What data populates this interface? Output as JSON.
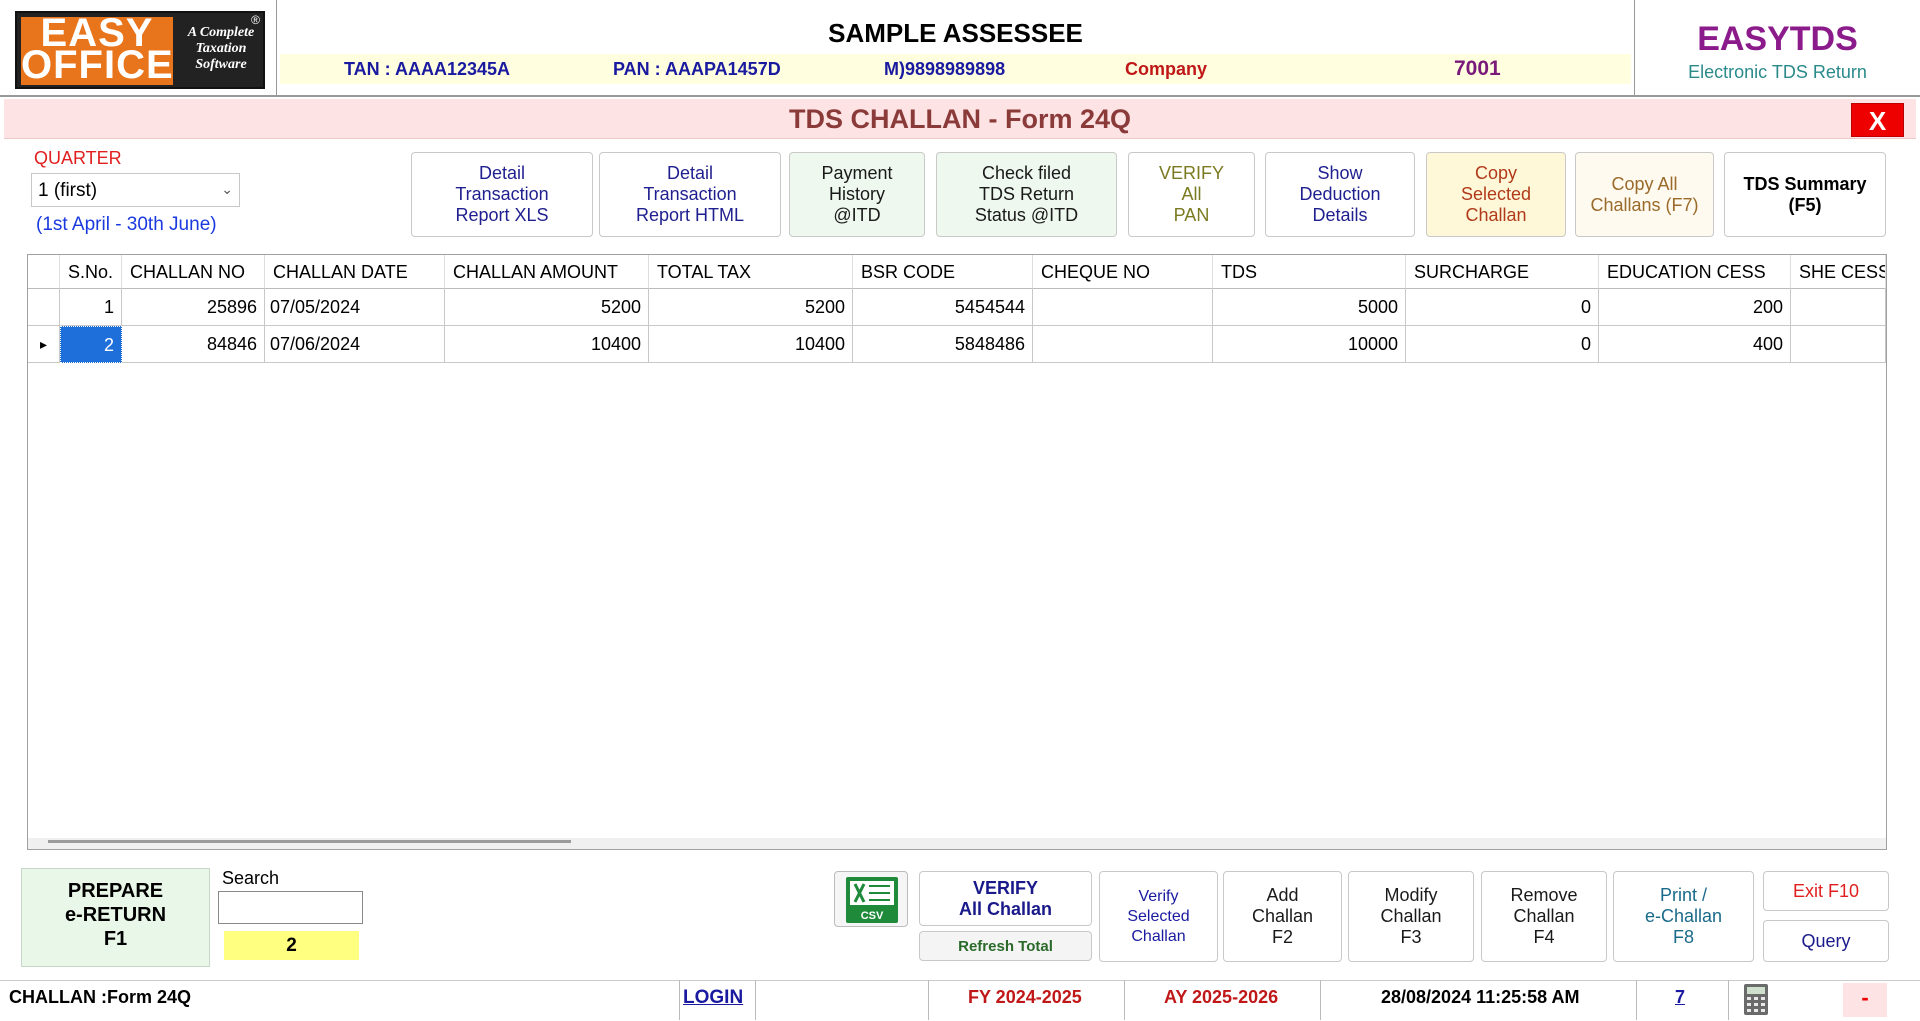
{
  "header": {
    "logo": {
      "line1": "EASY",
      "line2": "OFFICE",
      "tagline": [
        "A Complete",
        "Taxation",
        "Software"
      ],
      "reg": "®"
    },
    "assessee": "SAMPLE ASSESSEE",
    "tan": "TAN : AAAA12345A",
    "pan": "PAN : AAAPA1457D",
    "mobile": "M)9898989898",
    "type": "Company",
    "code": "7001",
    "brand": "EASYTDS",
    "brand_sub": "Electronic TDS Return"
  },
  "title": "TDS CHALLAN - Form 24Q",
  "close_label": "X",
  "quarter": {
    "label": "QUARTER",
    "selected": "1 (first)",
    "range": "(1st April - 30th June)"
  },
  "toolbar": [
    {
      "name": "detail-xls-button",
      "lines": [
        "Detail",
        "Transaction",
        "Report XLS"
      ],
      "bg": "#ffffff",
      "color": "#1f1f8f",
      "bold": false
    },
    {
      "name": "detail-html-button",
      "lines": [
        "Detail",
        "Transaction",
        "Report HTML"
      ],
      "bg": "#ffffff",
      "color": "#1f1f8f",
      "bold": false
    },
    {
      "name": "payment-history-button",
      "lines": [
        "Payment",
        "History",
        "@ITD"
      ],
      "bg": "#eef8ee",
      "color": "#1a1a1a",
      "bold": false
    },
    {
      "name": "check-filed-button",
      "lines": [
        "Check filed",
        "TDS Return",
        "Status @ITD"
      ],
      "bg": "#eef8ee",
      "color": "#1a1a1a",
      "bold": false
    },
    {
      "name": "verify-all-pan-button",
      "lines": [
        "VERIFY",
        "All",
        "PAN"
      ],
      "bg": "#ffffff",
      "color": "#7a7a20",
      "bold": false
    },
    {
      "name": "show-deduction-button",
      "lines": [
        "Show",
        "Deduction",
        "Details"
      ],
      "bg": "#ffffff",
      "color": "#1f1f8f",
      "bold": false
    },
    {
      "name": "copy-selected-challan-button",
      "lines": [
        "Copy",
        "Selected",
        "Challan"
      ],
      "bg": "#fff8d8",
      "color": "#b03a1a",
      "bold": false
    },
    {
      "name": "copy-all-challans-button",
      "lines": [
        "Copy All",
        "Challans (F7)"
      ],
      "bg": "#fffaf0",
      "color": "#9a6a2a",
      "bold": false
    },
    {
      "name": "tds-summary-button",
      "lines": [
        "TDS Summary",
        "(F5)"
      ],
      "bg": "#ffffff",
      "color": "#000000",
      "bold": true
    }
  ],
  "table": {
    "columns": [
      "",
      "S.No.",
      "CHALLAN NO",
      "CHALLAN DATE",
      "CHALLAN AMOUNT",
      "TOTAL TAX",
      "BSR CODE",
      "CHEQUE NO",
      "TDS",
      "SURCHARGE",
      "EDUCATION CESS",
      "SHE CESS"
    ],
    "rows": [
      {
        "indicator": "",
        "sno": "1",
        "challan_no": "25896",
        "challan_date": "07/05/2024",
        "amount": "5200",
        "total_tax": "5200",
        "bsr": "5454544",
        "cheque": "",
        "tds": "5000",
        "surcharge": "0",
        "edu_cess": "200",
        "she_cess": ""
      },
      {
        "indicator": "▸",
        "sno": "2",
        "challan_no": "84846",
        "challan_date": "07/06/2024",
        "amount": "10400",
        "total_tax": "10400",
        "bsr": "5848486",
        "cheque": "",
        "tds": "10000",
        "surcharge": "0",
        "edu_cess": "400",
        "she_cess": ""
      }
    ]
  },
  "bottom": {
    "prepare": [
      "PREPARE",
      "e-RETURN",
      "F1"
    ],
    "search_label": "Search",
    "search_value": "",
    "search_count": "2",
    "csv_label": "CSV",
    "verify_all": [
      "VERIFY",
      "All Challan"
    ],
    "refresh_total": "Refresh Total",
    "verify_selected": [
      "Verify",
      "Selected",
      "Challan"
    ],
    "add": [
      "Add",
      "Challan",
      "F2"
    ],
    "modify": [
      "Modify",
      "Challan",
      "F3"
    ],
    "remove": [
      "Remove",
      "Challan",
      "F4"
    ],
    "print": [
      "Print /",
      "e-Challan",
      "F8"
    ],
    "exit": "Exit F10",
    "query": "Query"
  },
  "status": {
    "form": "CHALLAN :Form 24Q",
    "login": "LOGIN",
    "fy": "FY 2024-2025",
    "ay": "AY 2025-2026",
    "datetime": "28/08/2024 11:25:58 AM",
    "count": "7",
    "min": "-"
  },
  "colors": {
    "accent_red": "#e00000",
    "title_bg": "#fde3e3",
    "selection": "#1e6fd9",
    "brand": "#8b1a8b"
  }
}
